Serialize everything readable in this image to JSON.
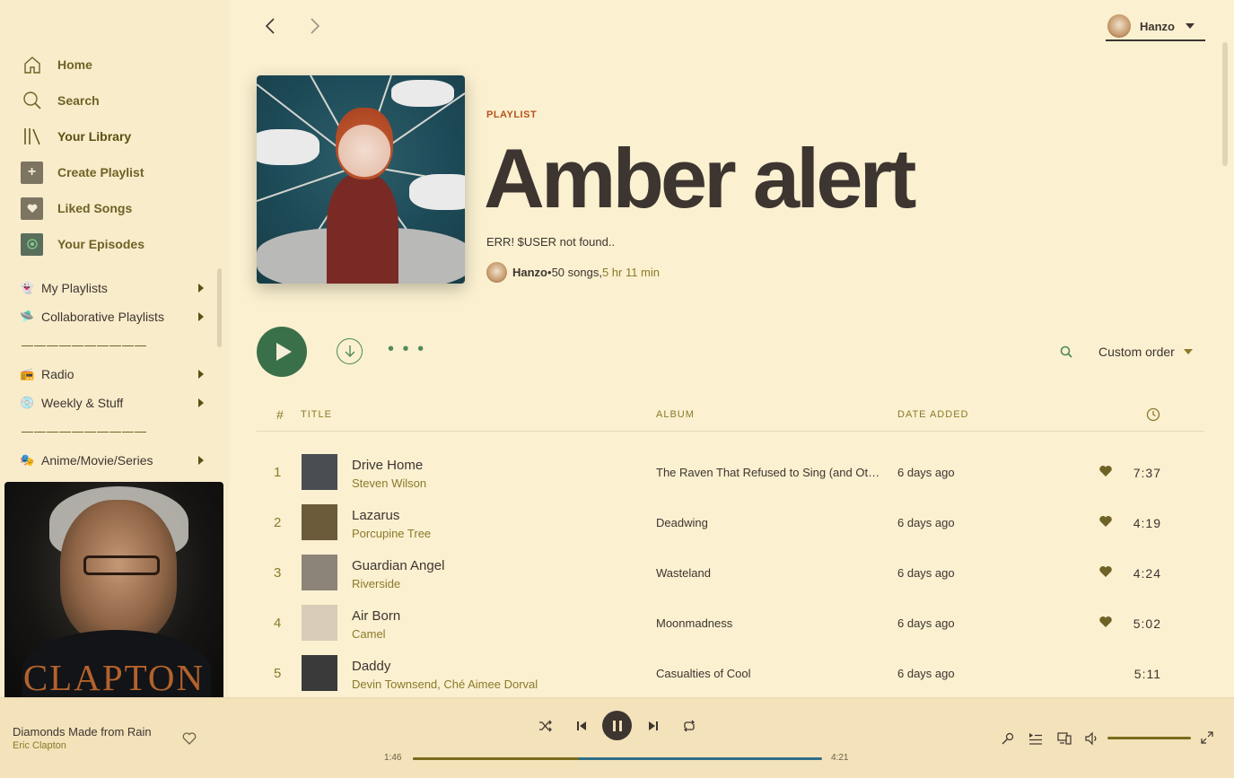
{
  "sidebar": {
    "nav": [
      {
        "label": "Home",
        "icon": "home-icon"
      },
      {
        "label": "Search",
        "icon": "search-icon"
      },
      {
        "label": "Your Library",
        "icon": "library-icon"
      },
      {
        "label": "Create Playlist",
        "icon": "plus-icon"
      },
      {
        "label": "Liked Songs",
        "icon": "heart-icon"
      },
      {
        "label": "Your Episodes",
        "icon": "podcast-icon"
      }
    ],
    "folders": [
      {
        "label": "My Playlists",
        "emoji": "👻"
      },
      {
        "label": "Collaborative Playlists",
        "emoji": "🛸"
      },
      {
        "divider": "——————————"
      },
      {
        "label": "Radio",
        "emoji": "📻"
      },
      {
        "label": "Weekly & Stuff",
        "emoji": "💿"
      },
      {
        "divider": "——————————"
      },
      {
        "label": "Anime/Movie/Series",
        "emoji": "🎭"
      }
    ],
    "now_playing_cover_text": "CLAPTON"
  },
  "user": {
    "name": "Hanzo"
  },
  "playlist": {
    "kicker": "PLAYLIST",
    "title": "Amber alert",
    "description": "ERR! $USER not found..",
    "owner": "Hanzo",
    "bullet": " • ",
    "song_count": "50 songs, ",
    "duration": "5 hr 11 min"
  },
  "actions": {
    "sort_label": "Custom order"
  },
  "table": {
    "headers": {
      "num": "#",
      "title": "TITLE",
      "album": "ALBUM",
      "date": "DATE ADDED"
    },
    "rows": [
      {
        "num": "1",
        "title": "Drive Home",
        "artist": "Steven Wilson",
        "album": "The Raven That Refused to Sing (and Other Stories)",
        "date": "6 days ago",
        "liked": true,
        "duration": "7:37",
        "thumb": "#4a4d52"
      },
      {
        "num": "2",
        "title": "Lazarus",
        "artist": "Porcupine Tree",
        "album": "Deadwing",
        "date": "6 days ago",
        "liked": true,
        "duration": "4:19",
        "thumb": "#6b5b3a"
      },
      {
        "num": "3",
        "title": "Guardian Angel",
        "artist": "Riverside",
        "album": "Wasteland",
        "date": "6 days ago",
        "liked": true,
        "duration": "4:24",
        "thumb": "#8c8478"
      },
      {
        "num": "4",
        "title": "Air Born",
        "artist": "Camel",
        "album": "Moonmadness",
        "date": "6 days ago",
        "liked": true,
        "duration": "5:02",
        "thumb": "#d9ccb8"
      },
      {
        "num": "5",
        "title": "Daddy",
        "artist": "Devin Townsend, Ché Aimee Dorval",
        "album": "Casualties of Cool",
        "date": "6 days ago",
        "liked": false,
        "duration": "5:11",
        "thumb": "#3a3a3a"
      }
    ]
  },
  "player": {
    "track": "Diamonds Made from Rain",
    "artist": "Eric Clapton",
    "elapsed": "1:46",
    "total": "4:21",
    "progress_fraction": 0.406,
    "volume_fraction": 1.0
  },
  "colors": {
    "accent": "#3a7049",
    "muted_gold": "#8a7a2a",
    "orange": "#b5541d",
    "background": "#fbf0d0"
  }
}
